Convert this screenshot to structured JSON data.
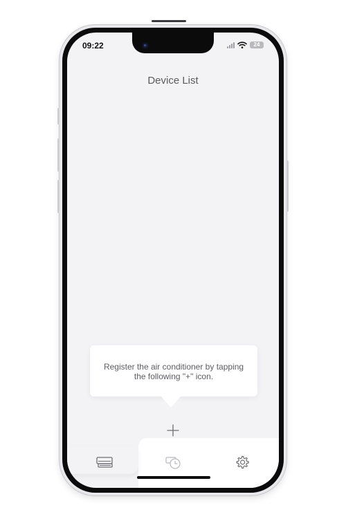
{
  "status_bar": {
    "time": "09:22",
    "battery": "24"
  },
  "header": {
    "title": "Device List"
  },
  "empty_state": {
    "hint": "Register the air conditioner by tapping the following \"+\" icon."
  },
  "actions": {
    "add_icon": "plus-icon"
  },
  "tab_bar": {
    "tabs": [
      {
        "name": "devices",
        "icon": "air-conditioner-icon",
        "active": true
      },
      {
        "name": "schedule",
        "icon": "timer-icon",
        "active": false
      },
      {
        "name": "settings",
        "icon": "gear-icon",
        "active": false
      }
    ]
  },
  "colors": {
    "screen_background": "#f3f3f6",
    "text_primary": "#5a5a5f",
    "icon": "#6e6e73"
  }
}
